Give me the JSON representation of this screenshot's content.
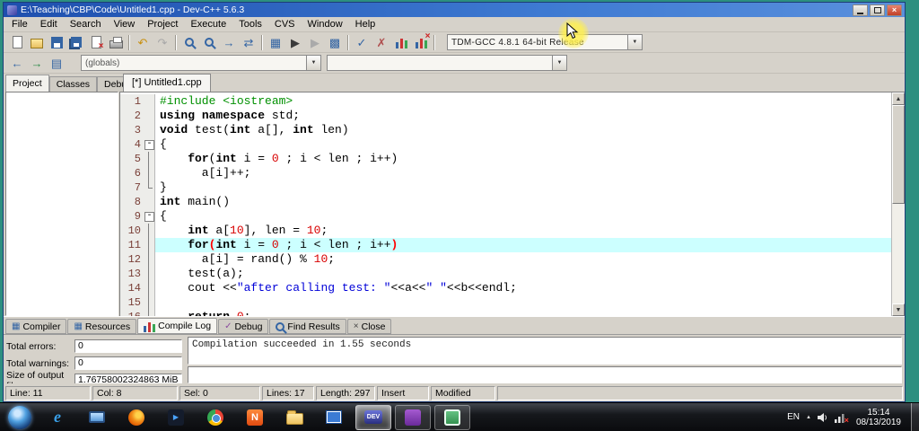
{
  "titlebar": {
    "title": "E:\\Teaching\\CBP\\Code\\Untitled1.cpp - Dev-C++ 5.6.3"
  },
  "menubar": [
    "File",
    "Edit",
    "Search",
    "View",
    "Project",
    "Execute",
    "Tools",
    "CVS",
    "Window",
    "Help"
  ],
  "toolbar1": {
    "compiler_combo": "TDM-GCC 4.8.1 64-bit Release",
    "icons": [
      {
        "name": "new-file-icon",
        "kind": "page"
      },
      {
        "name": "open-file-icon",
        "kind": "page-open"
      },
      {
        "name": "save-icon",
        "kind": "save"
      },
      {
        "name": "save-all-icon",
        "kind": "save-all"
      },
      {
        "name": "close-file-icon",
        "kind": "page-x"
      },
      {
        "name": "print-icon",
        "kind": "print"
      },
      {
        "sep": true
      },
      {
        "name": "undo-icon",
        "kind": "glyph",
        "glyph": "↶",
        "color": "#c89010"
      },
      {
        "name": "redo-icon",
        "kind": "glyph",
        "glyph": "↷",
        "color": "#a8a8a8"
      },
      {
        "sep": true
      },
      {
        "name": "find-icon",
        "kind": "mag"
      },
      {
        "name": "replace-icon",
        "kind": "mag"
      },
      {
        "name": "goto-line-icon",
        "kind": "glyph",
        "glyph": "→",
        "color": "#3465a4"
      },
      {
        "name": "swap-header-icon",
        "kind": "glyph",
        "glyph": "⇄",
        "color": "#3465a4"
      },
      {
        "sep": true
      },
      {
        "name": "compile-icon",
        "kind": "glyph",
        "glyph": "▦",
        "color": "#3465a4"
      },
      {
        "name": "run-icon",
        "kind": "glyph",
        "glyph": "▶",
        "color": "#3a3a3a"
      },
      {
        "name": "compile-run-icon",
        "kind": "glyph",
        "glyph": "▶",
        "color": "#aaaaaa"
      },
      {
        "name": "rebuild-icon",
        "kind": "glyph",
        "glyph": "▩",
        "color": "#3465a4"
      },
      {
        "sep": true
      },
      {
        "name": "syntax-check-icon",
        "kind": "glyph",
        "glyph": "✓",
        "color": "#3465a4"
      },
      {
        "name": "abort-icon",
        "kind": "glyph",
        "glyph": "✗",
        "color": "#b05050"
      },
      {
        "name": "profile-icon",
        "kind": "chart"
      },
      {
        "name": "profile-delete-icon",
        "kind": "chart-x"
      },
      {
        "sep": true
      }
    ]
  },
  "toolbar2": {
    "globals_combo": "(globals)",
    "members_combo": "",
    "buttons": [
      {
        "name": "goto-declaration-icon",
        "kind": "glyph",
        "glyph": "←",
        "color": "#3465a4"
      },
      {
        "name": "goto-definition-icon",
        "kind": "glyph",
        "glyph": "→",
        "color": "#2e8b4a"
      },
      {
        "name": "class-browser-icon",
        "kind": "glyph",
        "glyph": "▤",
        "color": "#3465a4"
      }
    ]
  },
  "left_panel": {
    "tabs": [
      {
        "label": "Project",
        "active": true
      },
      {
        "label": "Classes",
        "active": false
      },
      {
        "label": "Debug",
        "active": false
      }
    ]
  },
  "editor": {
    "tab": "[*] Untitled1.cpp",
    "highlight_line": 11,
    "lines": [
      {
        "n": 1,
        "seg": [
          [
            "p",
            "#include <iostream>"
          ]
        ]
      },
      {
        "n": 2,
        "seg": [
          [
            "k",
            "using"
          ],
          [
            "t",
            " "
          ],
          [
            "k",
            "namespace"
          ],
          [
            "t",
            " std;"
          ]
        ]
      },
      {
        "n": 3,
        "seg": [
          [
            "k",
            "void"
          ],
          [
            "t",
            " test("
          ],
          [
            "k",
            "int"
          ],
          [
            "t",
            " a[], "
          ],
          [
            "k",
            "int"
          ],
          [
            "t",
            " len)"
          ]
        ]
      },
      {
        "n": 4,
        "fold": "open",
        "seg": [
          [
            "t",
            "{"
          ]
        ]
      },
      {
        "n": 5,
        "fold": "mid",
        "seg": [
          [
            "t",
            "    "
          ],
          [
            "k",
            "for"
          ],
          [
            "t",
            "("
          ],
          [
            "k",
            "int"
          ],
          [
            "t",
            " i = "
          ],
          [
            "n",
            "0"
          ],
          [
            "t",
            " ; i < len ; i++)"
          ]
        ]
      },
      {
        "n": 6,
        "fold": "mid",
        "seg": [
          [
            "t",
            "      a[i]++;"
          ]
        ]
      },
      {
        "n": 7,
        "fold": "end",
        "seg": [
          [
            "t",
            "}"
          ]
        ]
      },
      {
        "n": 8,
        "seg": [
          [
            "k",
            "int"
          ],
          [
            "t",
            " main()"
          ]
        ]
      },
      {
        "n": 9,
        "fold": "open",
        "seg": [
          [
            "t",
            "{"
          ]
        ]
      },
      {
        "n": 10,
        "fold": "mid",
        "seg": [
          [
            "t",
            "    "
          ],
          [
            "k",
            "int"
          ],
          [
            "t",
            " a["
          ],
          [
            "n",
            "10"
          ],
          [
            "t",
            "], len = "
          ],
          [
            "n",
            "10"
          ],
          [
            "t",
            ";"
          ]
        ]
      },
      {
        "n": 11,
        "fold": "mid",
        "seg": [
          [
            "t",
            "    "
          ],
          [
            "k",
            "for"
          ],
          [
            "m",
            "("
          ],
          [
            "k",
            "int"
          ],
          [
            "t",
            " i = "
          ],
          [
            "n",
            "0"
          ],
          [
            "t",
            " ; i < len ; i++"
          ],
          [
            "m",
            ")"
          ]
        ]
      },
      {
        "n": 12,
        "fold": "mid",
        "seg": [
          [
            "t",
            "      a[i] = rand() % "
          ],
          [
            "n",
            "10"
          ],
          [
            "t",
            ";"
          ]
        ]
      },
      {
        "n": 13,
        "fold": "mid",
        "seg": [
          [
            "t",
            "    test(a);"
          ]
        ]
      },
      {
        "n": 14,
        "fold": "mid",
        "seg": [
          [
            "t",
            "    cout <<"
          ],
          [
            "s",
            "\"after calling test: \""
          ],
          [
            "t",
            "<<a<<"
          ],
          [
            "s",
            "\" \""
          ],
          [
            "t",
            "<<b<<endl;"
          ]
        ]
      },
      {
        "n": 15,
        "fold": "mid",
        "seg": [
          [
            "t",
            ""
          ]
        ]
      },
      {
        "n": 16,
        "fold": "mid",
        "seg": [
          [
            "t",
            "    "
          ],
          [
            "k",
            "return"
          ],
          [
            "t",
            " "
          ],
          [
            "n",
            "0"
          ],
          [
            "t",
            ";"
          ]
        ]
      }
    ]
  },
  "log_panel": {
    "tabs": [
      {
        "label": "Compiler",
        "icon": "grid",
        "active": false
      },
      {
        "label": "Resources",
        "icon": "grid",
        "active": false
      },
      {
        "label": "Compile Log",
        "icon": "chart",
        "active": true
      },
      {
        "label": "Debug",
        "icon": "check",
        "active": false
      },
      {
        "label": "Find Results",
        "icon": "mag",
        "active": false
      },
      {
        "label": "Close",
        "icon": "close",
        "active": false
      }
    ],
    "fields": [
      {
        "label": "Total errors:",
        "value": "0"
      },
      {
        "label": "Total warnings:",
        "value": "0"
      },
      {
        "label": "Size of output file:",
        "value": "1.76758002324863 MiB"
      }
    ],
    "message": "Compilation succeeded in 1.55 seconds"
  },
  "statusbar": [
    "Line: 11",
    "Col: 8",
    "Sel: 0",
    "Lines: 17",
    "Length: 297",
    "Insert",
    "Modified"
  ],
  "taskbar": {
    "tray": {
      "lang": "EN",
      "time": "15:14",
      "date": "08/13/2019"
    },
    "icons": [
      {
        "name": "taskbar-ie",
        "kind": "ie",
        "label": "e"
      },
      {
        "name": "taskbar-monitor",
        "kind": "monitor"
      },
      {
        "name": "taskbar-firefox",
        "kind": "firefox"
      },
      {
        "name": "taskbar-media-player",
        "kind": "player",
        "label": "▶"
      },
      {
        "name": "taskbar-chrome",
        "kind": "chrome"
      },
      {
        "name": "taskbar-nitro",
        "kind": "nitro",
        "label": "N"
      },
      {
        "name": "taskbar-explorer",
        "kind": "folder"
      },
      {
        "name": "taskbar-photos",
        "kind": "photos"
      },
      {
        "name": "taskbar-devcpp",
        "kind": "dev",
        "label": "DEV",
        "active": true
      },
      {
        "name": "taskbar-purple-app",
        "kind": "purple",
        "open": true
      },
      {
        "name": "taskbar-green-app",
        "kind": "green",
        "open": true
      }
    ]
  }
}
